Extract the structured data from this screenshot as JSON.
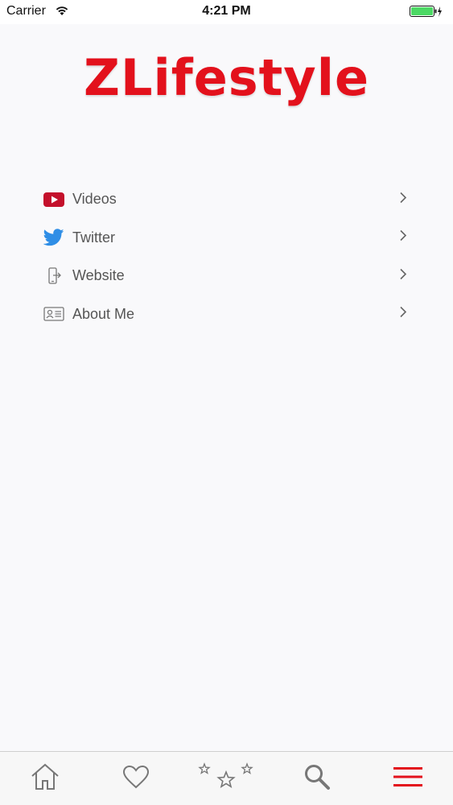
{
  "status_bar": {
    "carrier": "Carrier",
    "time": "4:21 PM",
    "wifi_icon": "wifi-icon",
    "battery_icon": "battery-charging-icon",
    "battery_color": "#4cd964"
  },
  "header": {
    "logo_text": "ZLifestyle",
    "logo_color": "#e3111c"
  },
  "menu": {
    "items": [
      {
        "label": "Videos",
        "icon": "youtube-icon"
      },
      {
        "label": "Twitter",
        "icon": "twitter-icon"
      },
      {
        "label": "Website",
        "icon": "phone-link-icon"
      },
      {
        "label": "About Me",
        "icon": "id-card-icon"
      }
    ],
    "chevron_icon": "chevron-right-icon"
  },
  "tab_bar": {
    "tabs": [
      {
        "icon": "home-icon"
      },
      {
        "icon": "heart-icon"
      },
      {
        "icon": "stars-icon"
      },
      {
        "icon": "search-icon"
      },
      {
        "icon": "menu-icon",
        "active": true
      }
    ],
    "active_color": "#e3111c",
    "inactive_color": "#777777"
  }
}
